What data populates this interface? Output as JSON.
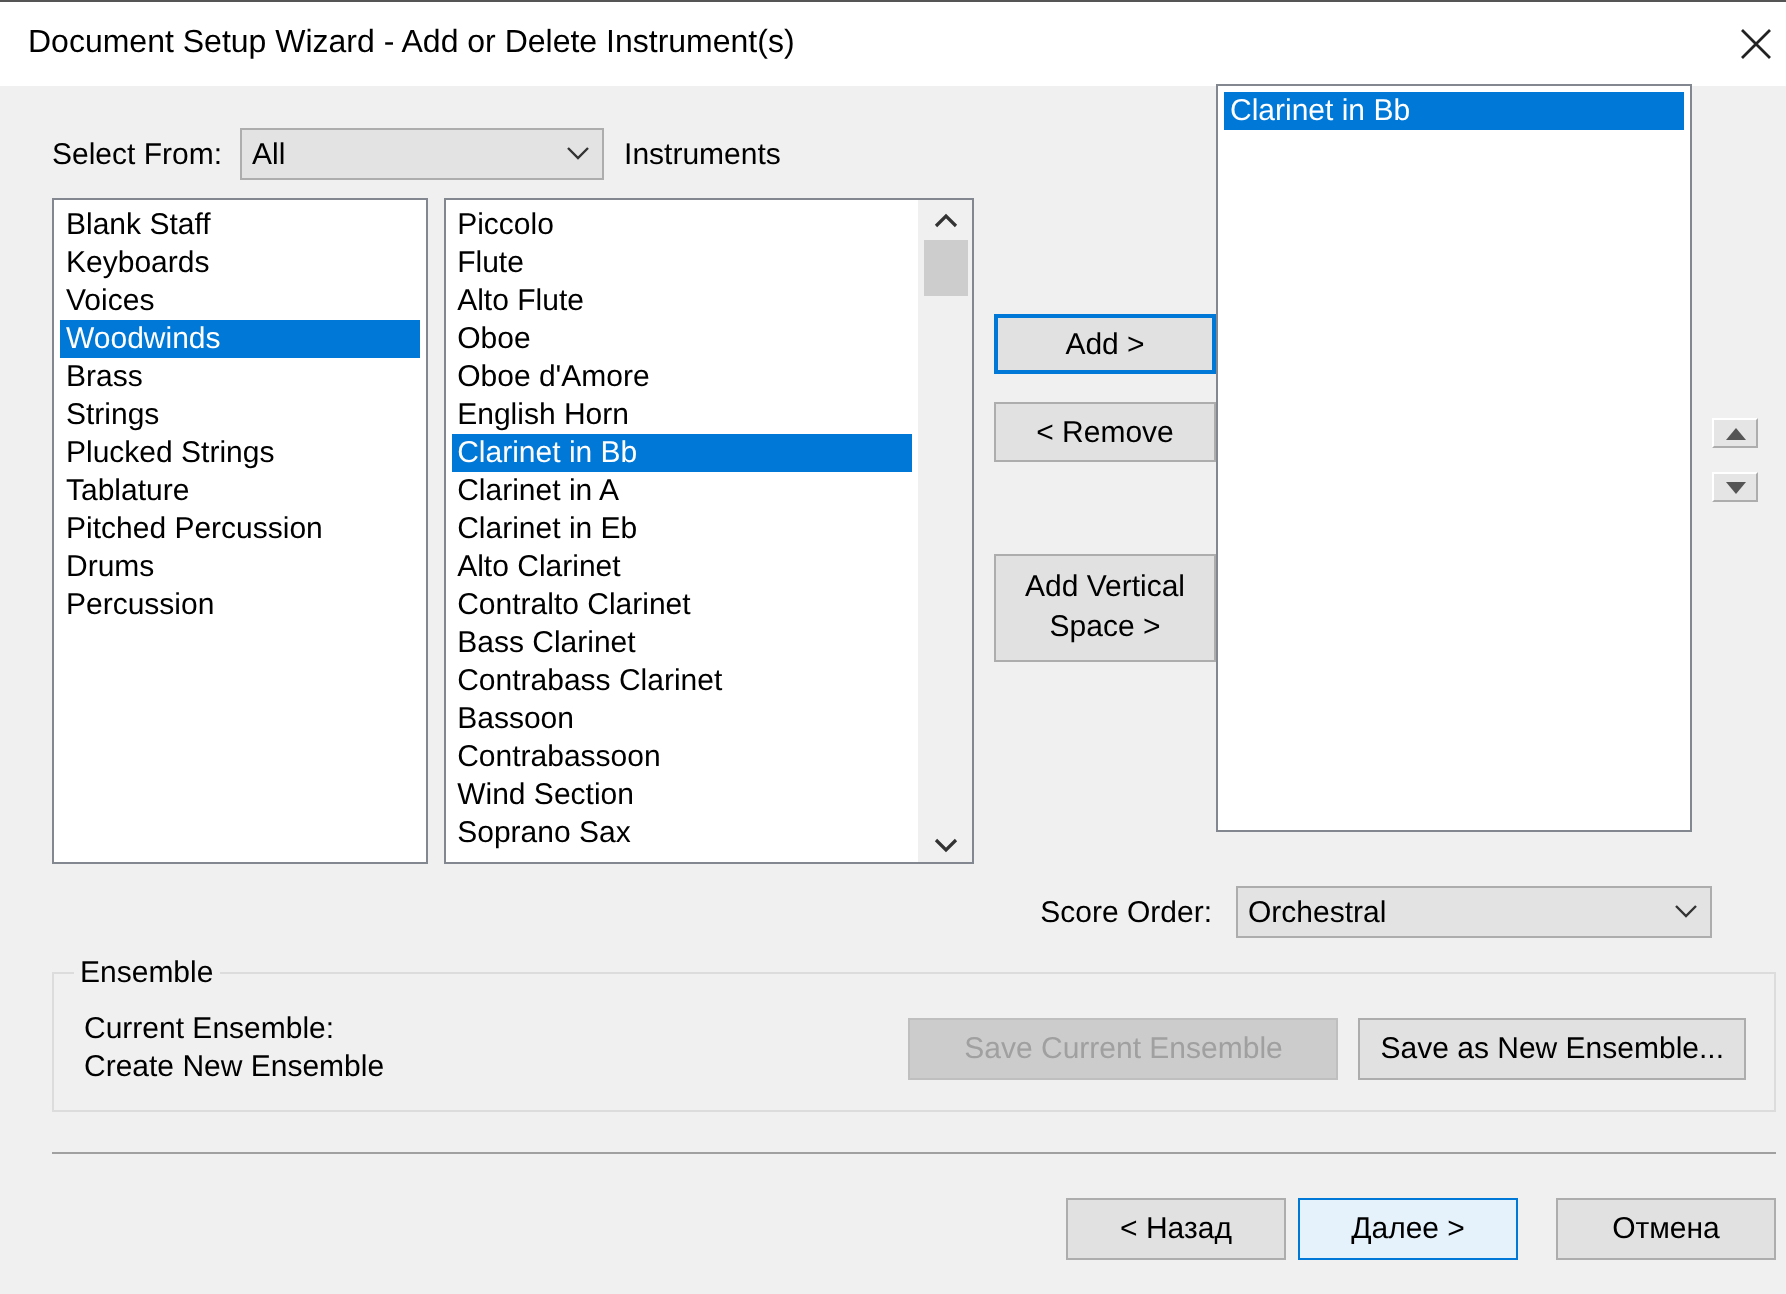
{
  "window": {
    "title": "Document Setup Wizard - Add or Delete Instrument(s)"
  },
  "select_from": {
    "label": "Select From:",
    "value": "All",
    "suffix": "Instruments"
  },
  "categories": [
    {
      "label": "Blank Staff",
      "selected": false
    },
    {
      "label": "Keyboards",
      "selected": false
    },
    {
      "label": "Voices",
      "selected": false
    },
    {
      "label": "Woodwinds",
      "selected": true
    },
    {
      "label": "Brass",
      "selected": false
    },
    {
      "label": "Strings",
      "selected": false
    },
    {
      "label": "Plucked Strings",
      "selected": false
    },
    {
      "label": "Tablature",
      "selected": false
    },
    {
      "label": "Pitched Percussion",
      "selected": false
    },
    {
      "label": "Drums",
      "selected": false
    },
    {
      "label": "Percussion",
      "selected": false
    }
  ],
  "instruments": [
    {
      "label": "Piccolo",
      "selected": false
    },
    {
      "label": "Flute",
      "selected": false
    },
    {
      "label": "Alto Flute",
      "selected": false
    },
    {
      "label": "Oboe",
      "selected": false
    },
    {
      "label": "Oboe d'Amore",
      "selected": false
    },
    {
      "label": "English Horn",
      "selected": false
    },
    {
      "label": "Clarinet in Bb",
      "selected": true
    },
    {
      "label": "Clarinet in A",
      "selected": false
    },
    {
      "label": "Clarinet in Eb",
      "selected": false
    },
    {
      "label": "Alto Clarinet",
      "selected": false
    },
    {
      "label": "Contralto Clarinet",
      "selected": false
    },
    {
      "label": "Bass Clarinet",
      "selected": false
    },
    {
      "label": "Contrabass Clarinet",
      "selected": false
    },
    {
      "label": "Bassoon",
      "selected": false
    },
    {
      "label": "Contrabassoon",
      "selected": false
    },
    {
      "label": "Wind Section",
      "selected": false
    },
    {
      "label": "Soprano Sax",
      "selected": false
    }
  ],
  "actions": [
    {
      "label": "Add >",
      "focused": true
    },
    {
      "label": "< Remove",
      "focused": false
    },
    {
      "label": "Add Vertical Space >",
      "focused": false
    }
  ],
  "score": [
    {
      "label": "Clarinet in Bb",
      "selected": true
    }
  ],
  "score_order": {
    "label": "Score Order:",
    "value": "Orchestral"
  },
  "ensemble": {
    "title": "Ensemble",
    "current_label": "Current Ensemble:",
    "current_value": "Create New Ensemble",
    "buttons": [
      {
        "label": "Save Current Ensemble",
        "disabled": true
      },
      {
        "label": "Save as New Ensemble...",
        "disabled": false
      }
    ]
  },
  "nav": [
    {
      "label": "< Назад",
      "default": false
    },
    {
      "label": "Далее >",
      "default": true
    },
    {
      "label": "Отмена",
      "default": false
    }
  ]
}
